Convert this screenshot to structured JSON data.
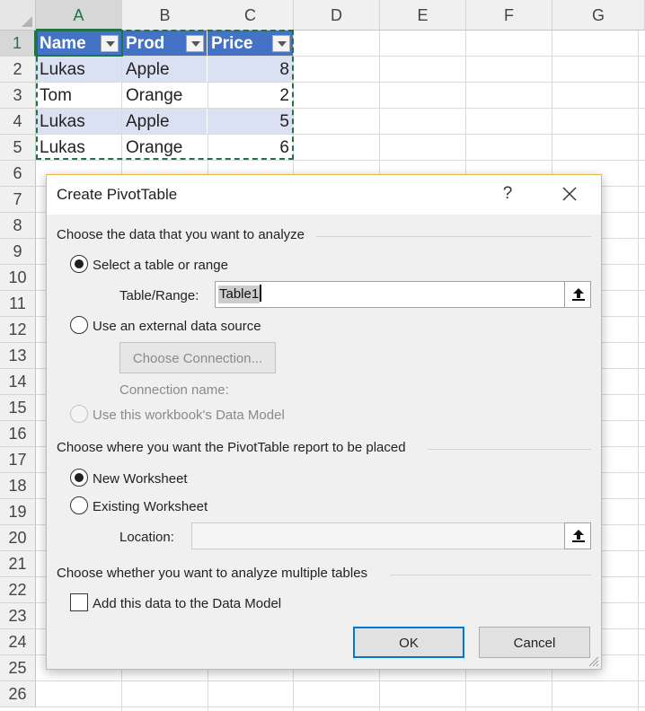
{
  "sheet": {
    "columns": [
      "A",
      "B",
      "C",
      "D",
      "E",
      "F",
      "G"
    ],
    "rows": [
      "1",
      "2",
      "3",
      "4",
      "5",
      "6",
      "7",
      "8",
      "9",
      "10",
      "11",
      "12",
      "13",
      "14",
      "15",
      "16",
      "17",
      "18",
      "19",
      "20",
      "21",
      "22",
      "23",
      "24",
      "25",
      "26"
    ],
    "table": {
      "headers": [
        "Name",
        "Prod",
        "Price"
      ],
      "data": [
        [
          "Lukas",
          "Apple",
          "8"
        ],
        [
          "Tom",
          "Orange",
          "2"
        ],
        [
          "Lukas",
          "Apple",
          "5"
        ],
        [
          "Lukas",
          "Orange",
          "6"
        ]
      ]
    },
    "colors": {
      "header": "#4472c4",
      "band": "#d9e1f2",
      "selection": "#217346"
    }
  },
  "dialog": {
    "title": "Create PivotTable",
    "help": "?",
    "section1": {
      "label": "Choose the data that you want to analyze",
      "option_table": "Select a table or range",
      "table_range_label": "Table/Range:",
      "table_range_value": "Table1",
      "option_external": "Use an external data source",
      "choose_connection_button": "Choose Connection...",
      "connection_name_label": "Connection name:",
      "option_data_model": "Use this workbook's Data Model"
    },
    "section2": {
      "label": "Choose where you want the PivotTable report to be placed",
      "option_new": "New Worksheet",
      "option_existing": "Existing Worksheet",
      "location_label": "Location:",
      "location_value": ""
    },
    "section3": {
      "label": "Choose whether you want to analyze multiple tables",
      "add_to_model": "Add this data to the Data Model"
    },
    "buttons": {
      "ok": "OK",
      "cancel": "Cancel"
    },
    "colors": {
      "accent": "#0078d7",
      "border": "#e8b84a"
    }
  }
}
